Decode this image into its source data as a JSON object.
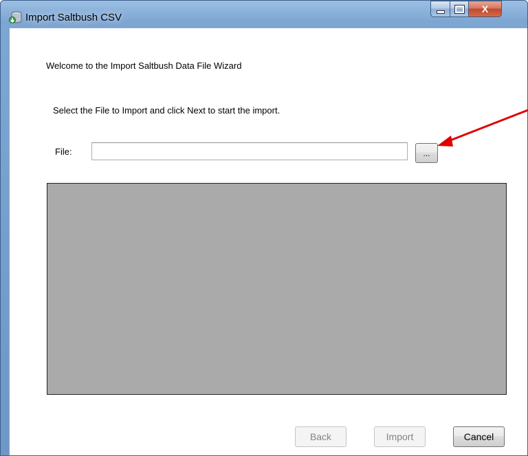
{
  "window": {
    "title": "Import Saltbush CSV",
    "close_glyph": "X",
    "app_icon": "import-database-icon"
  },
  "wizard": {
    "welcome_text": "Welcome to the Import Saltbush Data File Wizard",
    "instruction_text": "Select the File to Import and click Next to start the import.",
    "file_label": "File:",
    "file_value": "",
    "browse_label": "..."
  },
  "buttons": {
    "back_label": "Back",
    "import_label": "Import",
    "cancel_label": "Cancel",
    "back_enabled": false,
    "import_enabled": false
  },
  "colors": {
    "preview_background": "#aaaaaa",
    "annotation_arrow": "#e00000"
  }
}
